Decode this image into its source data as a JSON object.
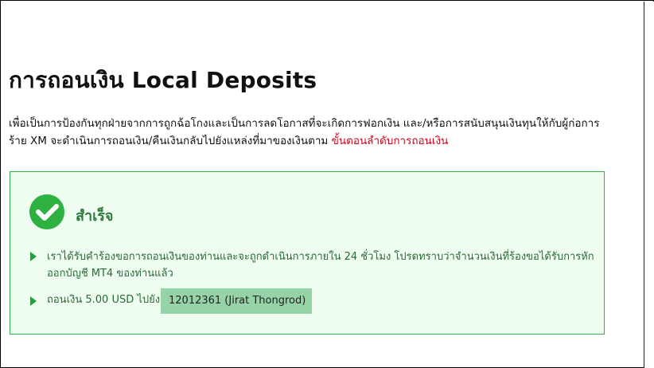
{
  "page": {
    "title": "การถอนเงิน Local Deposits",
    "intro_text": "เพื่อเป็นการป้องกันทุกฝ่ายจากการถูกฉ้อโกงและเป็นการลดโอกาสที่จะเกิดการฟอกเงิน และ/หรือการสนับสนุนเงินทุนให้กับผู้ก่อการร้าย XM จะดำเนินการถอนเงิน/คืนเงินกลับไปยังแหล่งที่มาของเงินตาม ",
    "intro_link": "ขั้นตอนลำดับการถอนเงิน"
  },
  "success": {
    "title": "สำเร็จ",
    "message_1": "เราได้รับคำร้องขอการถอนเงินของท่านและจะถูกดำเนินการภายใน 24 ชั่วโมง โปรดทราบว่าจำนวนเงินที่ร้องขอได้รับการหักออกบัญชี MT4 ของท่านแล้ว",
    "message_2_prefix": "ถอนเงิน 5.00 USD ไปยัง",
    "account": "12012361 (Jirat Thongrod)"
  },
  "colors": {
    "link": "#d0021b",
    "success_border": "#33b24a",
    "success_bg": "#effdf0",
    "check": "#2fb142",
    "account_chip": "#96d4a8"
  },
  "icons": {
    "status": "check-circle-icon",
    "bullet": "triangle-right-icon"
  }
}
